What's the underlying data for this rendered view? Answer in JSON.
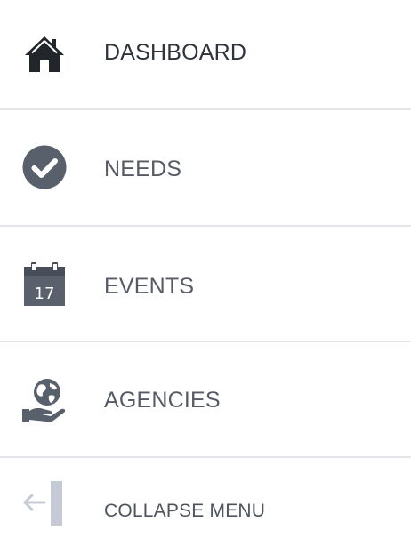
{
  "menu": {
    "items": [
      {
        "label": "DASHBOARD",
        "icon": "home-icon"
      },
      {
        "label": "NEEDS",
        "icon": "check-circle-icon"
      },
      {
        "label": "EVENTS",
        "icon": "calendar-icon",
        "calendar_day": "17"
      },
      {
        "label": "AGENCIES",
        "icon": "globe-hand-icon"
      }
    ],
    "collapse": {
      "label": "COLLAPSE MENU",
      "icon": "collapse-arrow-icon"
    }
  },
  "colors": {
    "icon_dark": "#2b2f35",
    "icon_gray": "#5b6370",
    "text": "#565b66",
    "divider": "#e4e6ea",
    "collapse_icon": "#c6cad6"
  }
}
